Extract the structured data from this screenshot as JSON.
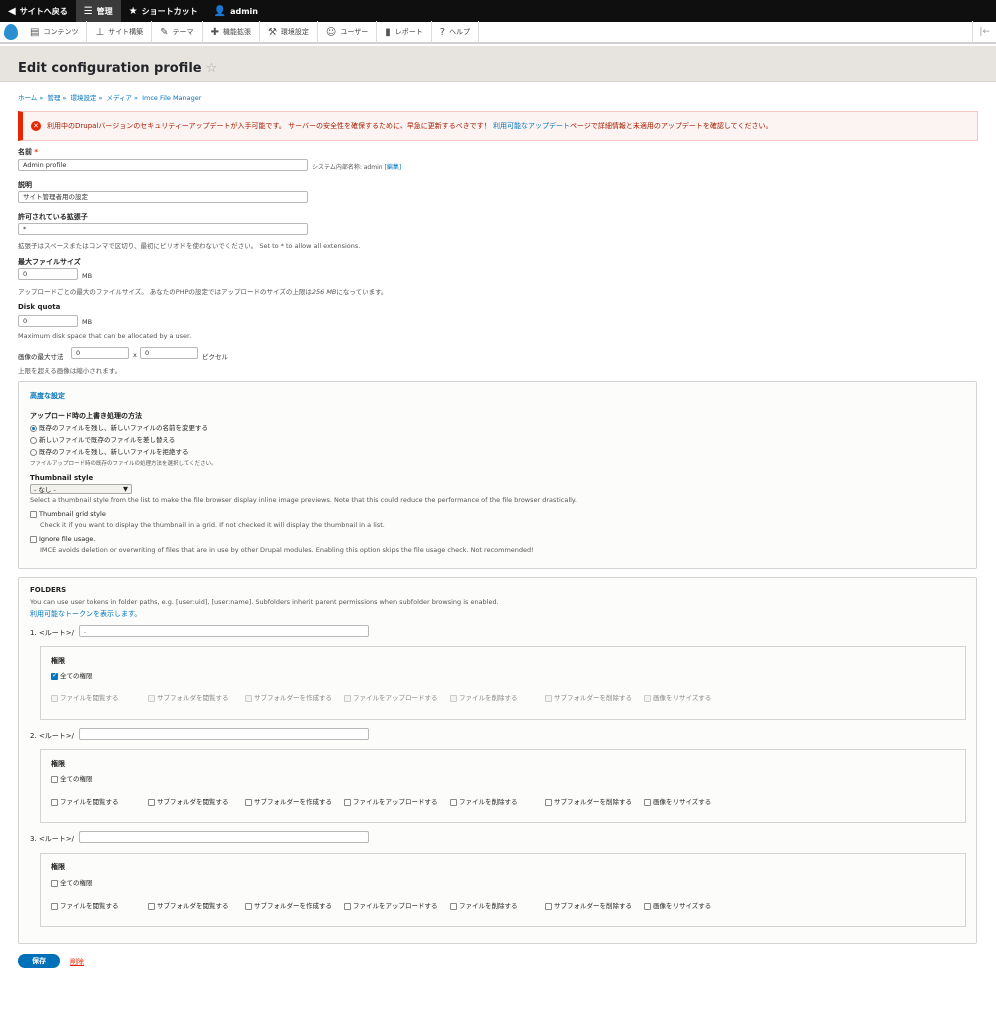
{
  "toolbar": {
    "back": "サイトへ戻る",
    "manage": "管理",
    "shortcuts": "ショートカット",
    "user": "admin"
  },
  "tray": [
    {
      "label": "コンテンツ",
      "icon": "file-icon"
    },
    {
      "label": "サイト構築",
      "icon": "sitemap-icon"
    },
    {
      "label": "テーマ",
      "icon": "paintbrush-icon"
    },
    {
      "label": "機能拡張",
      "icon": "puzzle-icon"
    },
    {
      "label": "環境設定",
      "icon": "wrench-icon"
    },
    {
      "label": "ユーザー",
      "icon": "people-icon"
    },
    {
      "label": "レポート",
      "icon": "bar-chart-icon"
    },
    {
      "label": "ヘルプ",
      "icon": "help-icon"
    }
  ],
  "page": {
    "title": "Edit configuration profile",
    "breadcrumb": [
      "ホーム",
      "管理",
      "環境設定",
      "メディア",
      "Imce File Manager"
    ]
  },
  "message": {
    "text": "利用中のDrupalバージョンのセキュリティーアップデートが入手可能です。 サーバーの安全性を確保するために、早急に更新するべきです！",
    "link": "利用可能なアップデート",
    "tail": "ページで詳細情報と未適用のアップデートを確認してください。"
  },
  "form": {
    "name_label": "名前",
    "name_value": "Admin profile",
    "machine_prefix": "システム内部名称: admin",
    "machine_edit": "[編集]",
    "desc_label": "説明",
    "desc_value": "サイト管理者用の設定",
    "ext_label": "許可されている拡張子",
    "ext_value": "*",
    "ext_help": "拡張子はスペースまたはコンマで区切り、最初にピリオドを使わないでください。 Set to * to allow all extensions.",
    "maxsize_label": "最大ファイルサイズ",
    "maxsize_value": "0",
    "mb": "MB",
    "maxsize_help_a": "アップロードごとの最大のファイルサイズ。 あなたのPHPの設定ではアップロードのサイズの上限は",
    "maxsize_help_b": "256 MB",
    "maxsize_help_c": "になっています。",
    "quota_label": "Disk quota",
    "quota_value": "0",
    "quota_help": "Maximum disk space that can be allocated by a user.",
    "dim_label": "画像の最大寸法",
    "dim_w": "0",
    "dim_x": "x",
    "dim_h": "0",
    "dim_unit": "ピクセル",
    "dim_help": "上限を超える画像は縮小されます。"
  },
  "advanced": {
    "summary": "高度な設定",
    "replace_label": "アップロード時の上書き処理の方法",
    "opt1": "既存のファイルを残し、新しいファイルの名前を変更する",
    "opt2": "新しいファイルで既存のファイルを差し替える",
    "opt3": "既存のファイルを残し、新しいファイルを拒絶する",
    "replace_help": "ファイルアップロード時の既存のファイルの処理方法を選択してください。",
    "thumb_label": "Thumbnail style",
    "thumb_value": "- なし -",
    "thumb_help": "Select a thumbnail style from the list to make the file browser display inline image previews. Note that this could reduce the performance of the file browser drastically.",
    "grid_label": "Thumbnail grid style",
    "grid_help": "Check it if you want to display the thumbnail in a grid. If not checked it will display the thumbnail in a list.",
    "usage_label": "Ignore file usage.",
    "usage_help": "IMCE avoids deletion or overwriting of files that are in use by other Drupal modules. Enabling this option skips the file usage check. Not recommended!"
  },
  "folders": {
    "title": "FOLDERS",
    "help": "You can use user tokens in folder paths, e.g. [user:uid], [user:name]. Subfolders inherit parent permissions when subfolder browsing is enabled.",
    "token_link": "利用可能なトークンを表示します。",
    "root": "<ルート>/",
    "perm_title": "権限",
    "all": "全ての権限",
    "perms": [
      "ファイルを閲覧する",
      "サブフォルダを閲覧する",
      "サブフォルダーを作成する",
      "ファイルをアップロードする",
      "ファイルを削除する",
      "サブフォルダーを削除する",
      "画像をリサイズする"
    ],
    "items": [
      {
        "num": "1.",
        "path": "."
      },
      {
        "num": "2.",
        "path": ""
      },
      {
        "num": "3.",
        "path": ""
      }
    ]
  },
  "actions": {
    "save": "保存",
    "delete": "削除"
  }
}
